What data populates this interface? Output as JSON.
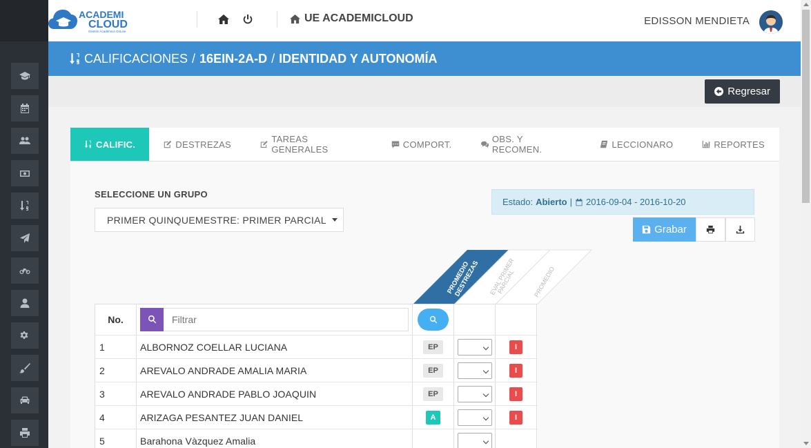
{
  "app": {
    "logo_top": "ACADEMI",
    "logo_main": "CLOUD",
    "logo_sub": "Gestión Académica OnLine",
    "brand": "UE ACADEMICLOUD",
    "user": "EDISSON MENDIETA"
  },
  "breadcrumb": {
    "section": "CALIFICACIONES",
    "sep": "/",
    "course": "16EIN-2A-D",
    "subject": "IDENTIDAD Y AUTONOMÍA"
  },
  "actions": {
    "back": "Regresar"
  },
  "tabs": [
    {
      "label": "CALIFIC.",
      "icon": "sort-numeric-icon"
    },
    {
      "label": "DESTREZAS",
      "icon": "edit-icon"
    },
    {
      "label": "TAREAS GENERALES",
      "icon": "edit-icon"
    },
    {
      "label": "COMPORT.",
      "icon": "comment-icon"
    },
    {
      "label": "OBS. Y RECOMEN.",
      "icon": "comments-icon"
    },
    {
      "label": "LECCIONARO",
      "icon": "book-icon"
    },
    {
      "label": "REPORTES",
      "icon": "bar-chart-icon"
    }
  ],
  "group": {
    "label": "SELECCIONE UN GRUPO",
    "selected": "PRIMER QUINQUEMESTRE: PRIMER PARCIAL"
  },
  "status": {
    "label": "Estado:",
    "value": "Abierto",
    "sep": "|",
    "range": "2016-09-04 - 2016-10-20"
  },
  "toolbar": {
    "save": "Grabar"
  },
  "columns": {
    "no": "No.",
    "filter_placeholder": "Filtrar",
    "col1": "PROMEDIO DESTREZAS",
    "col2": "EVAL PRIMER PARCIAL",
    "col3": "PROMEDIO"
  },
  "students": [
    {
      "no": "1",
      "name": "ALBORNOZ COELLAR LUCIANA",
      "badge": "EP",
      "grade": "I"
    },
    {
      "no": "2",
      "name": "AREVALO ANDRADE AMALIA MARIA",
      "badge": "EP",
      "grade": "I"
    },
    {
      "no": "3",
      "name": "AREVALO ANDRADE PABLO JOAQUIN",
      "badge": "EP",
      "grade": "I"
    },
    {
      "no": "4",
      "name": "ARIZAGA PESANTEZ JUAN DANIEL",
      "badge": "A",
      "grade": "I"
    },
    {
      "no": "5",
      "name": "Barahona Vàzquez Amalia",
      "badge": "",
      "grade": ""
    }
  ],
  "colors": {
    "accent": "#3d8fd1",
    "teal": "#1ec8b8",
    "danger": "#e84c4c",
    "purple": "#7c54b8"
  }
}
